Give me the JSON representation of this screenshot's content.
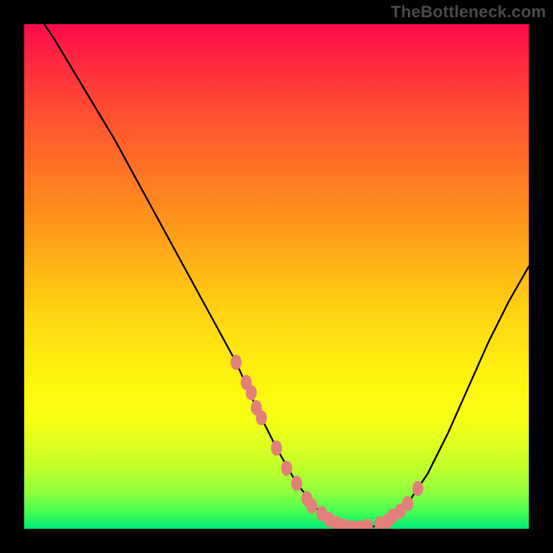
{
  "watermark": "TheBottleneck.com",
  "chart_data": {
    "type": "line",
    "title": "",
    "xlabel": "",
    "ylabel": "",
    "xlim": [
      0,
      100
    ],
    "ylim": [
      0,
      100
    ],
    "series": [
      {
        "name": "curve",
        "x": [
          0,
          6,
          12,
          18,
          24,
          30,
          36,
          42,
          46,
          50,
          54,
          58,
          62,
          66,
          68,
          72,
          76,
          80,
          84,
          88,
          92,
          96,
          100
        ],
        "values": [
          106,
          97,
          87,
          77,
          66,
          55,
          44,
          33,
          24,
          16,
          9,
          4,
          1,
          0,
          0,
          1.5,
          5,
          11,
          19,
          28,
          37,
          45,
          52
        ]
      }
    ],
    "markers": {
      "name": "highlight-dots",
      "color": "#e37f7a",
      "x": [
        42,
        44,
        45,
        46,
        47,
        50,
        52,
        54,
        56,
        57,
        59,
        60.5,
        62,
        63.5,
        65,
        66.5,
        68,
        70.5,
        72,
        73,
        74.5,
        76,
        78
      ],
      "y": [
        33,
        29,
        27,
        24,
        22,
        16,
        12,
        9,
        6,
        4.5,
        3,
        1.8,
        1,
        0.5,
        0.2,
        0.2,
        0.5,
        1,
        1.5,
        2.5,
        3.5,
        5,
        8
      ]
    },
    "gradient_stops": [
      {
        "pos": 0.0,
        "color": "#ff0a4a"
      },
      {
        "pos": 0.5,
        "color": "#ffd012"
      },
      {
        "pos": 0.8,
        "color": "#f5ff14"
      },
      {
        "pos": 1.0,
        "color": "#00e676"
      }
    ]
  }
}
